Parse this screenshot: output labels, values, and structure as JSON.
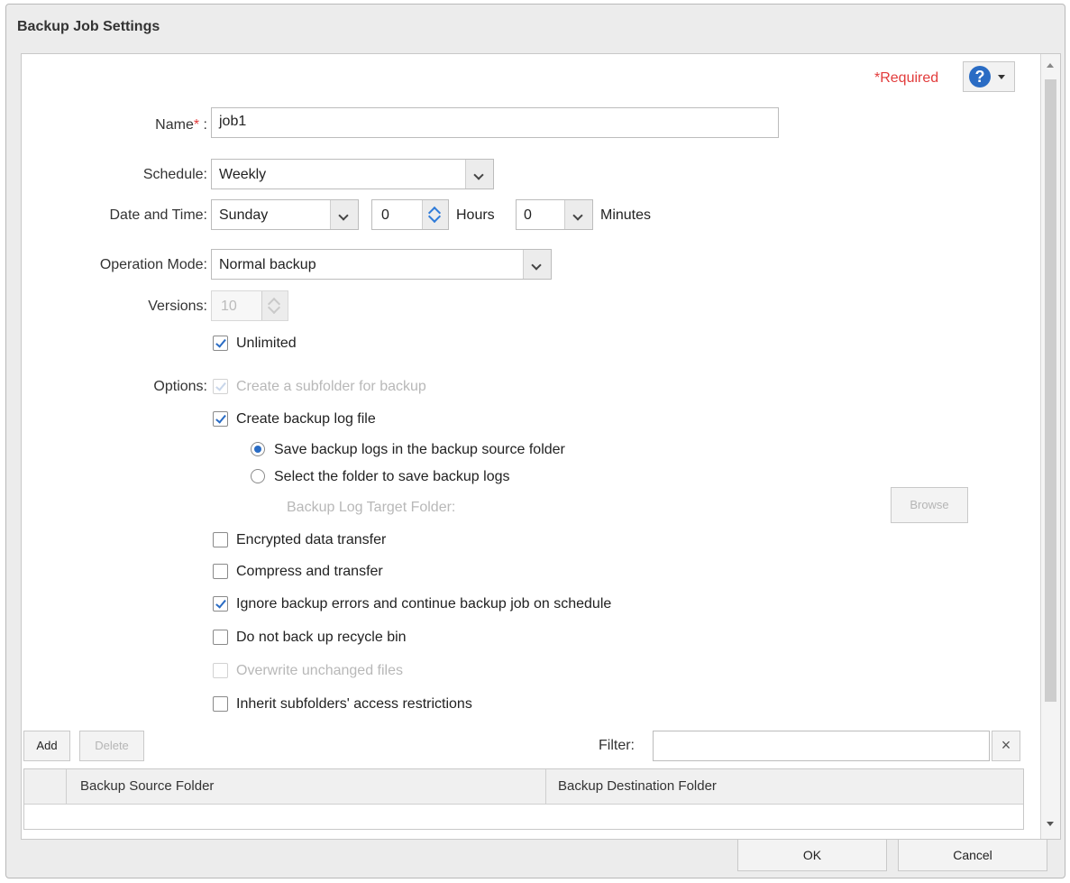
{
  "dialog": {
    "title": "Backup Job Settings"
  },
  "required_note": "*Required",
  "help_icon": "question-icon",
  "form": {
    "name_label": "Name",
    "name_required_mark": "*",
    "name_colon": ":",
    "name_value": "job1",
    "schedule_label": "Schedule:",
    "schedule_value": "Weekly",
    "datetime_label": "Date and Time:",
    "day_value": "Sunday",
    "hours_value": "0",
    "hours_label": "Hours",
    "minutes_value": "0",
    "minutes_label": "Minutes",
    "mode_label": "Operation Mode:",
    "mode_value": "Normal backup",
    "versions_label": "Versions:",
    "versions_value": "10",
    "unlimited_label": "Unlimited",
    "options_label": "Options:"
  },
  "options": {
    "subfolder": "Create a subfolder for backup",
    "logfile": "Create backup log file",
    "radio_source": "Save backup logs in the backup source folder",
    "radio_select": "Select the folder to save backup logs",
    "log_target_label": "Backup Log Target Folder:",
    "browse": "Browse",
    "encrypted": "Encrypted data transfer",
    "compress": "Compress and transfer",
    "ignore_errors": "Ignore backup errors and continue backup job on schedule",
    "recycle": "Do not back up recycle bin",
    "overwrite": "Overwrite unchanged files",
    "inherit": "Inherit subfolders' access restrictions"
  },
  "list": {
    "add": "Add",
    "delete": "Delete",
    "filter_label": "Filter:",
    "filter_value": "",
    "clear_icon": "×",
    "columns": [
      "Backup Source Folder",
      "Backup Destination Folder"
    ]
  },
  "footer": {
    "ok": "OK",
    "cancel": "Cancel"
  },
  "colors": {
    "accent": "#2a6cc4",
    "required": "#e23b3b"
  }
}
